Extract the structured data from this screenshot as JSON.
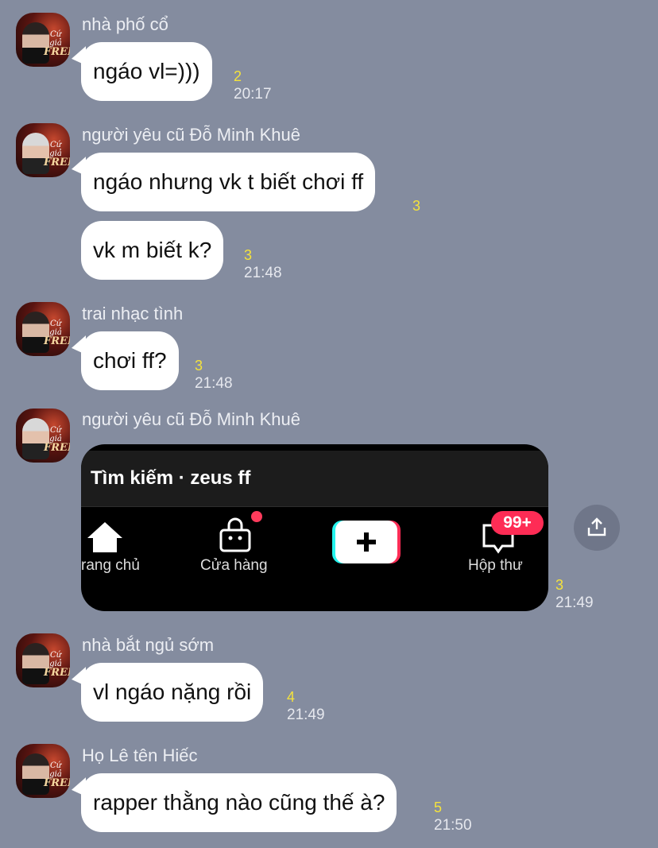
{
  "messages": [
    {
      "sender": "nhà phố cổ",
      "bubbles": [
        {
          "text": "ngáo vl=)))",
          "read": "2",
          "time": "20:17"
        }
      ]
    },
    {
      "sender": "người yêu cũ Đỗ Minh Khuê",
      "bubbles": [
        {
          "text": "ngáo nhưng vk t biết chơi ff",
          "read": "3",
          "time": ""
        },
        {
          "text": "vk m biết k?",
          "read": "3",
          "time": "21:48"
        }
      ]
    },
    {
      "sender": "trai nhạc tình",
      "bubbles": [
        {
          "text": "chơi ff?",
          "read": "3",
          "time": "21:48"
        }
      ]
    },
    {
      "sender": "người yêu cũ Đỗ Minh Khuê",
      "image": {
        "search_text": "Tìm kiếm · zeus ff",
        "nav": {
          "home": "rang chủ",
          "shop": "Cửa hàng",
          "inbox": "Hộp thư",
          "badge": "99+"
        },
        "read": "3",
        "time": "21:49"
      }
    },
    {
      "sender": "nhà bắt ngủ sớm",
      "bubbles": [
        {
          "text": "vl ngáo nặng rồi",
          "read": "4",
          "time": "21:49"
        }
      ]
    },
    {
      "sender": "Họ Lê tên Hiếc",
      "bubbles": [
        {
          "text": "rapper thằng nào cũng thế à?",
          "read": "5",
          "time": "21:50"
        }
      ]
    }
  ],
  "avatar_text": {
    "line1": "Cứ giả",
    "line2": "FREE"
  },
  "colors": {
    "background": "#848c9f",
    "bubble": "#ffffff",
    "read_count": "#f4e23c",
    "badge": "#fe2c55"
  },
  "icons": {
    "share": "share-icon"
  }
}
